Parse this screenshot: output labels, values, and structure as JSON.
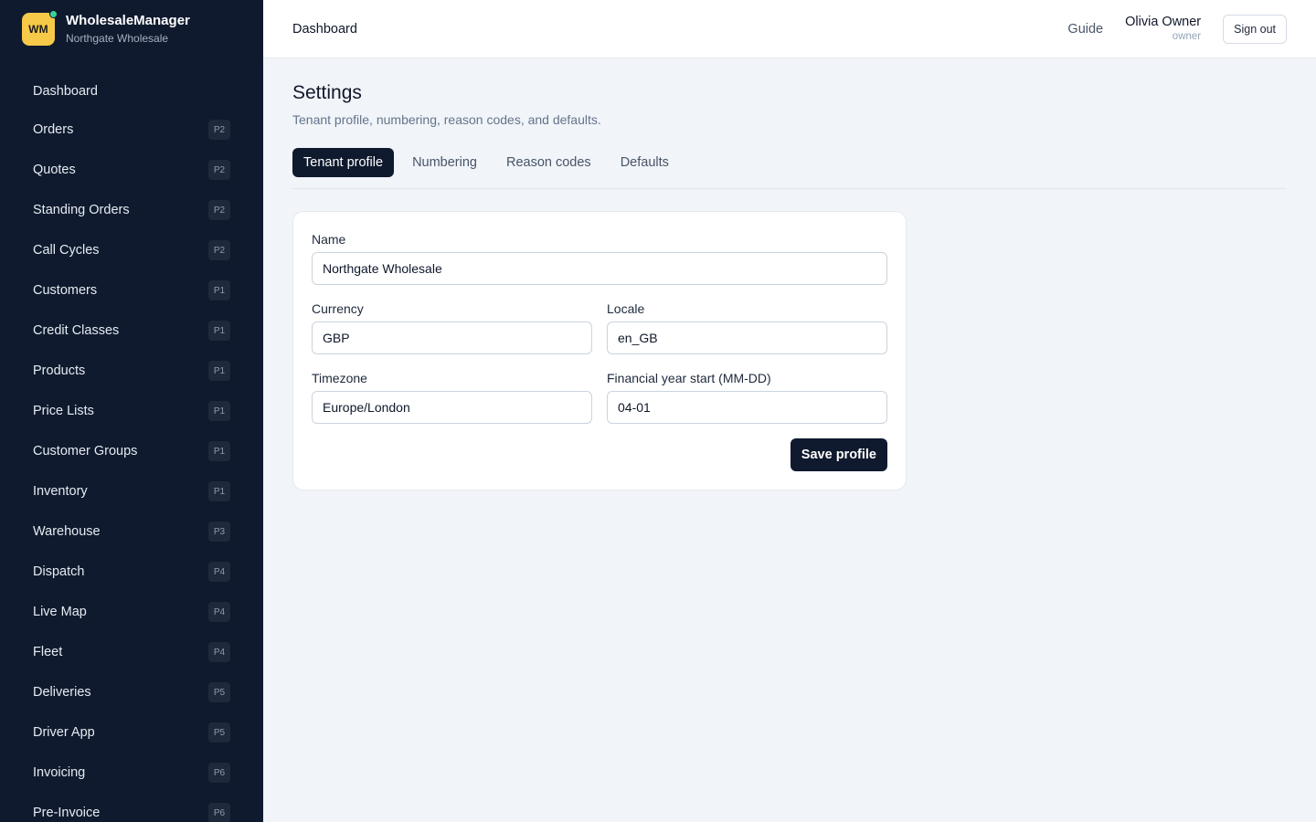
{
  "brand": {
    "logo_text": "WM",
    "name": "WholesaleManager",
    "tenant": "Northgate Wholesale"
  },
  "sidebar": {
    "items": [
      {
        "label": "Dashboard",
        "badge": ""
      },
      {
        "label": "Orders",
        "badge": "P2"
      },
      {
        "label": "Quotes",
        "badge": "P2"
      },
      {
        "label": "Standing Orders",
        "badge": "P2"
      },
      {
        "label": "Call Cycles",
        "badge": "P2"
      },
      {
        "label": "Customers",
        "badge": "P1"
      },
      {
        "label": "Credit Classes",
        "badge": "P1"
      },
      {
        "label": "Products",
        "badge": "P1"
      },
      {
        "label": "Price Lists",
        "badge": "P1"
      },
      {
        "label": "Customer Groups",
        "badge": "P1"
      },
      {
        "label": "Inventory",
        "badge": "P1"
      },
      {
        "label": "Warehouse",
        "badge": "P3"
      },
      {
        "label": "Dispatch",
        "badge": "P4"
      },
      {
        "label": "Live Map",
        "badge": "P4"
      },
      {
        "label": "Fleet",
        "badge": "P4"
      },
      {
        "label": "Deliveries",
        "badge": "P5"
      },
      {
        "label": "Driver App",
        "badge": "P5"
      },
      {
        "label": "Invoicing",
        "badge": "P6"
      },
      {
        "label": "Pre-Invoice",
        "badge": "P6"
      }
    ]
  },
  "header": {
    "title": "Dashboard",
    "guide_label": "Guide",
    "user_name": "Olivia Owner",
    "user_role": "owner",
    "signout_label": "Sign out"
  },
  "page": {
    "title": "Settings",
    "subtitle": "Tenant profile, numbering, reason codes, and defaults.",
    "tabs": [
      {
        "label": "Tenant profile",
        "active": true
      },
      {
        "label": "Numbering",
        "active": false
      },
      {
        "label": "Reason codes",
        "active": false
      },
      {
        "label": "Defaults",
        "active": false
      }
    ]
  },
  "form": {
    "name_label": "Name",
    "name_value": "Northgate Wholesale",
    "currency_label": "Currency",
    "currency_value": "GBP",
    "locale_label": "Locale",
    "locale_value": "en_GB",
    "timezone_label": "Timezone",
    "timezone_value": "Europe/London",
    "fy_label": "Financial year start (MM-DD)",
    "fy_value": "04-01",
    "save_label": "Save profile"
  },
  "colors": {
    "sidebar_bg": "#0f1a2e",
    "logo_bg": "#f7c948",
    "status_dot": "#34d399",
    "primary_button": "#0f1a2e",
    "page_bg": "#f1f4f8"
  }
}
